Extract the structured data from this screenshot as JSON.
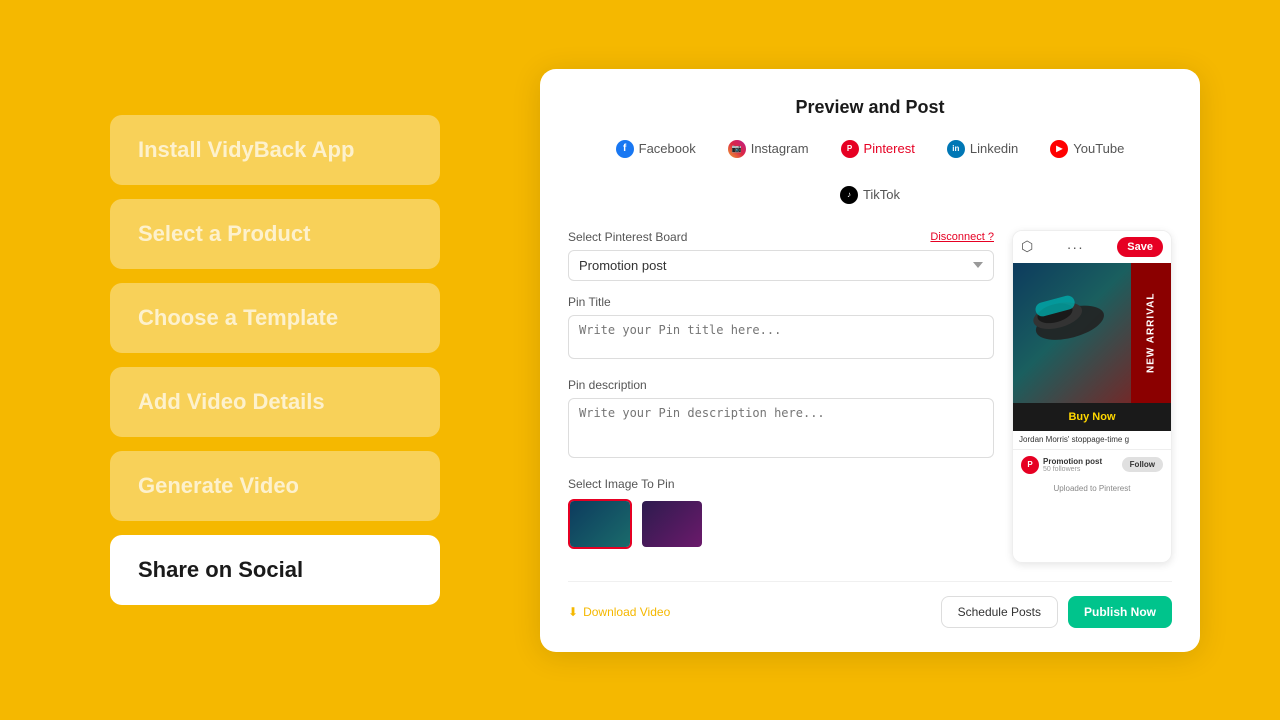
{
  "background_color": "#F5B800",
  "sidebar": {
    "steps": [
      {
        "id": "install",
        "label": "Install VidyBack App",
        "state": "inactive"
      },
      {
        "id": "select-product",
        "label": "Select a Product",
        "state": "inactive"
      },
      {
        "id": "choose-template",
        "label": "Choose a Template",
        "state": "inactive"
      },
      {
        "id": "add-video",
        "label": "Add Video Details",
        "state": "inactive"
      },
      {
        "id": "generate",
        "label": "Generate Video",
        "state": "inactive"
      },
      {
        "id": "share",
        "label": "Share on Social",
        "state": "active"
      }
    ]
  },
  "panel": {
    "title": "Preview and Post",
    "tabs": [
      {
        "id": "facebook",
        "label": "Facebook",
        "icon": "f",
        "icon_style": "fb"
      },
      {
        "id": "instagram",
        "label": "Instagram",
        "icon": "ig",
        "icon_style": "ig"
      },
      {
        "id": "pinterest",
        "label": "Pinterest",
        "icon": "P",
        "icon_style": "pt",
        "active": true
      },
      {
        "id": "linkedin",
        "label": "Linkedin",
        "icon": "in",
        "icon_style": "li"
      },
      {
        "id": "youtube",
        "label": "YouTube",
        "icon": "▶",
        "icon_style": "yt"
      },
      {
        "id": "tiktok",
        "label": "TikTok",
        "icon": "♪",
        "icon_style": "tt"
      }
    ],
    "form": {
      "board_label": "Select Pinterest Board",
      "board_value": "Promotion post",
      "disconnect_label": "Disconnect ?",
      "title_label": "Pin Title",
      "title_placeholder": "Write your Pin title here...",
      "description_label": "Pin description",
      "description_placeholder": "Write your Pin description here...",
      "images_label": "Select Image To Pin"
    },
    "preview": {
      "save_btn": "Save",
      "caption": "Jordan Morris' stoppage-time g",
      "buy_now": "Buy Now",
      "new_arrival": "NEW ARRIVAL",
      "board_name": "Promotion post",
      "followers": "50 followers",
      "follow_btn": "Follow",
      "uploaded_text": "Uploaded to Pinterest"
    },
    "footer": {
      "download_label": "Download Video",
      "schedule_label": "Schedule Posts",
      "publish_label": "Publish Now"
    }
  }
}
